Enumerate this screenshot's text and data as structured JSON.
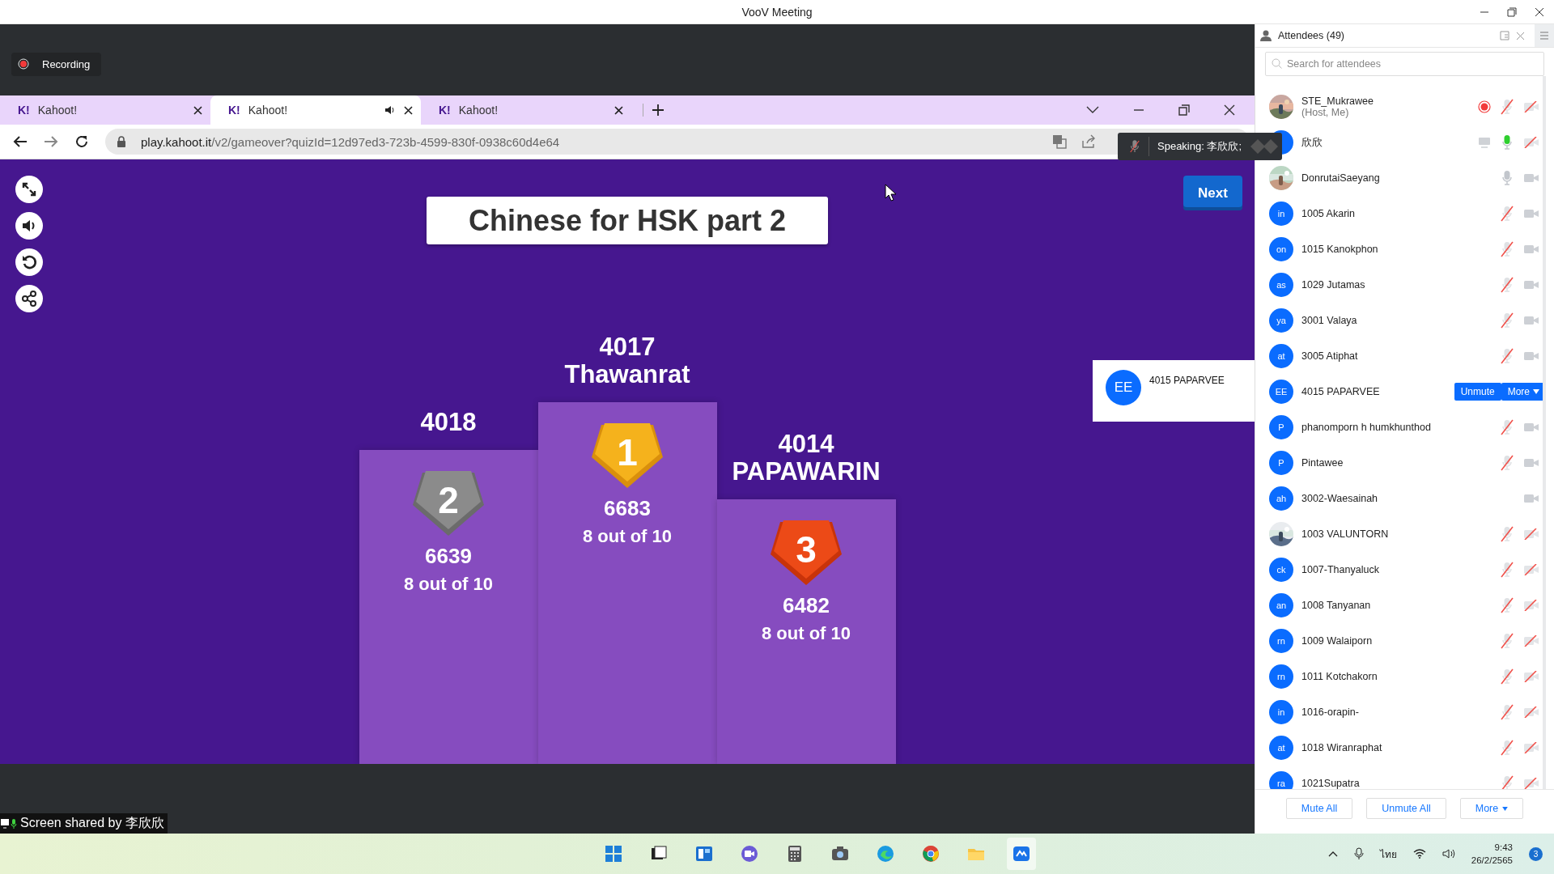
{
  "window": {
    "title": "VooV Meeting"
  },
  "recording": {
    "label": "Recording"
  },
  "browser": {
    "tabs": [
      {
        "favicon": "K!",
        "label": "Kahoot!",
        "selected": false,
        "audio": false
      },
      {
        "favicon": "K!",
        "label": "Kahoot!",
        "selected": true,
        "audio": true
      },
      {
        "favicon": "K!",
        "label": "Kahoot!",
        "selected": false,
        "audio": false
      }
    ],
    "url_host": "play.kahoot.it",
    "url_path": "/v2/gameover?quizId=12d97ed3-723b-4599-830f-0938c60d4e64"
  },
  "kahoot": {
    "title": "Chinese for HSK part 2",
    "next_button": "Next",
    "podium": [
      {
        "rank": "2",
        "name": "4018",
        "score": "6639",
        "detail": "8 out of 10"
      },
      {
        "rank": "1",
        "name": "4017 Thawanrat",
        "score": "6683",
        "detail": "8 out of 10"
      },
      {
        "rank": "3",
        "name": "4014 PAPAWARIN",
        "score": "6482",
        "detail": "8 out of 10"
      }
    ]
  },
  "video_tile": {
    "initials": "EE",
    "name": "4015 PAPARVEE"
  },
  "speaking": {
    "label": "Speaking: 李欣欣;"
  },
  "screen_share": {
    "label": "Screen shared by 李欣欣"
  },
  "attendees": {
    "title": "Attendees (49)",
    "search_placeholder": "Search for attendees",
    "items": [
      {
        "photo": true,
        "name": "STE_Mukrawee",
        "subtitle": "(Host, Me)",
        "recording": true,
        "sharing": false,
        "mic_shown": true,
        "muted": true,
        "speaking": false,
        "camera_off": true
      },
      {
        "photo": false,
        "name": "欣欣",
        "recording": false,
        "sharing": true,
        "mic_shown": true,
        "muted": false,
        "speaking": true,
        "camera_off": true
      },
      {
        "photo": true,
        "name": "DonrutaiSaeyang",
        "recording": false,
        "sharing": false,
        "mic_shown": true,
        "muted": false,
        "speaking": false,
        "camera_off": false
      },
      {
        "photo": false,
        "initials": "in",
        "name": "1005 Akarin",
        "recording": false,
        "sharing": false,
        "mic_shown": true,
        "muted": true,
        "speaking": false,
        "camera_off": false
      },
      {
        "photo": false,
        "initials": "on",
        "name": "1015 Kanokphon",
        "recording": false,
        "sharing": false,
        "mic_shown": true,
        "muted": true,
        "speaking": false,
        "camera_off": false
      },
      {
        "photo": false,
        "initials": "as",
        "name": "1029 Jutamas",
        "recording": false,
        "sharing": false,
        "mic_shown": true,
        "muted": true,
        "speaking": false,
        "camera_off": false
      },
      {
        "photo": false,
        "initials": "ya",
        "name": "3001 Valaya",
        "recording": false,
        "sharing": false,
        "mic_shown": true,
        "muted": true,
        "speaking": false,
        "camera_off": false
      },
      {
        "photo": false,
        "initials": "at",
        "name": "3005 Atiphat",
        "recording": false,
        "sharing": false,
        "mic_shown": true,
        "muted": true,
        "speaking": false,
        "camera_off": false
      },
      {
        "photo": false,
        "initials": "EE",
        "name": "4015 PAPARVEE",
        "recording": false,
        "sharing": false,
        "actions": [
          "Unmute",
          "More"
        ]
      },
      {
        "photo": false,
        "initials": "P",
        "name": "phanomporn h humkhunthod",
        "recording": false,
        "sharing": false,
        "mic_shown": true,
        "muted": true,
        "speaking": false,
        "camera_off": false
      },
      {
        "photo": false,
        "initials": "P",
        "name": "Pintawee",
        "recording": false,
        "sharing": false,
        "mic_shown": true,
        "muted": true,
        "speaking": false,
        "camera_off": false
      },
      {
        "photo": false,
        "initials": "ah",
        "name": "3002-Waesainah",
        "recording": false,
        "sharing": false,
        "mic_shown": false,
        "camera_off": false
      },
      {
        "photo": true,
        "name": "1003 VALUNTORN",
        "recording": false,
        "sharing": false,
        "mic_shown": true,
        "muted": true,
        "speaking": false,
        "camera_off": true
      },
      {
        "photo": false,
        "initials": "ck",
        "name": "1007-Thanyaluck",
        "recording": false,
        "sharing": false,
        "mic_shown": true,
        "muted": true,
        "speaking": false,
        "camera_off": true
      },
      {
        "photo": false,
        "initials": "an",
        "name": "1008 Tanyanan",
        "recording": false,
        "sharing": false,
        "mic_shown": true,
        "muted": true,
        "speaking": false,
        "camera_off": true
      },
      {
        "photo": false,
        "initials": "rn",
        "name": "1009 Walaiporn",
        "recording": false,
        "sharing": false,
        "mic_shown": true,
        "muted": true,
        "speaking": false,
        "camera_off": true
      },
      {
        "photo": false,
        "initials": "rn",
        "name": "1011 Kotchakorn",
        "recording": false,
        "sharing": false,
        "mic_shown": true,
        "muted": true,
        "speaking": false,
        "camera_off": true
      },
      {
        "photo": false,
        "initials": "in",
        "name": "1016-orapin-",
        "recording": false,
        "sharing": false,
        "mic_shown": true,
        "muted": true,
        "speaking": false,
        "camera_off": true
      },
      {
        "photo": false,
        "initials": "at",
        "name": "1018 Wiranraphat",
        "recording": false,
        "sharing": false,
        "mic_shown": true,
        "muted": true,
        "speaking": false,
        "camera_off": true
      },
      {
        "photo": false,
        "initials": "ra",
        "name": "1021Supatra",
        "recording": false,
        "sharing": false,
        "mic_shown": true,
        "muted": true,
        "speaking": false,
        "camera_off": true
      }
    ],
    "footer_buttons": [
      "Mute All",
      "Unmute All",
      "More"
    ]
  },
  "taskbar": {
    "language": "ไทย",
    "time": "9:43",
    "date": "26/2/2565",
    "notifications": "3"
  }
}
